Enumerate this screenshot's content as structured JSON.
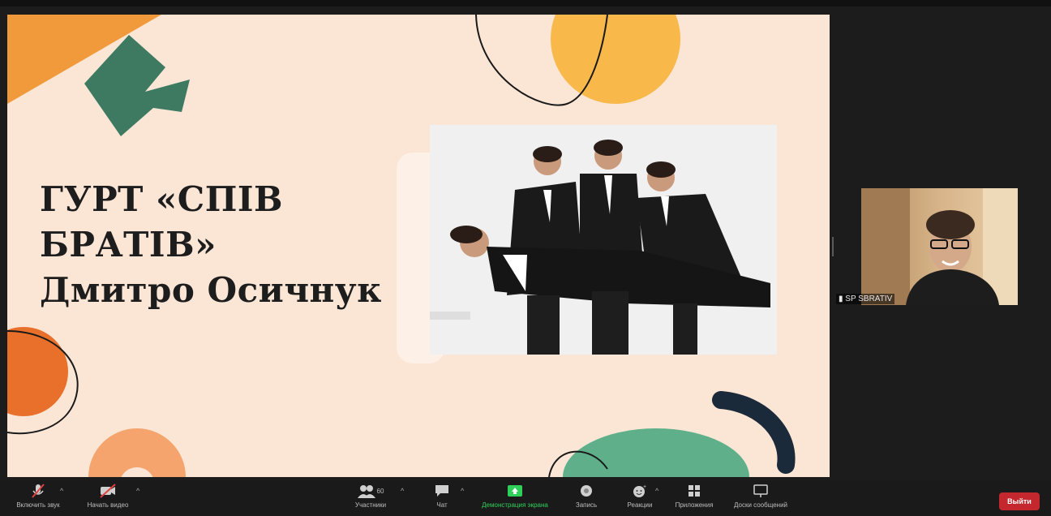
{
  "slide": {
    "title_lines": [
      "ГУРТ «СПІВ",
      "БРАТІВ»",
      "Дмитро Осичнук"
    ],
    "photo_alt": "Group photo"
  },
  "participant": {
    "name": "SP SBRATIV"
  },
  "toolbar": {
    "mute_label": "Включить звук",
    "video_label": "Начать видео",
    "participants_label": "Участники",
    "participants_count": "60",
    "chat_label": "Чат",
    "share_label": "Демонстрация экрана",
    "record_label": "Запись",
    "reactions_label": "Реакции",
    "apps_label": "Приложения",
    "whiteboards_label": "Доски сообщений",
    "leave_label": "Выйти"
  },
  "colors": {
    "share_green": "#2ed05a",
    "leave_red": "#c4282e",
    "slide_bg": "#fbe6d6"
  },
  "icons": [
    "microphone-muted-icon",
    "video-off-icon",
    "participants-icon",
    "chat-icon",
    "share-screen-icon",
    "record-icon",
    "reactions-icon",
    "apps-icon",
    "whiteboard-icon",
    "caret-up-icon"
  ]
}
